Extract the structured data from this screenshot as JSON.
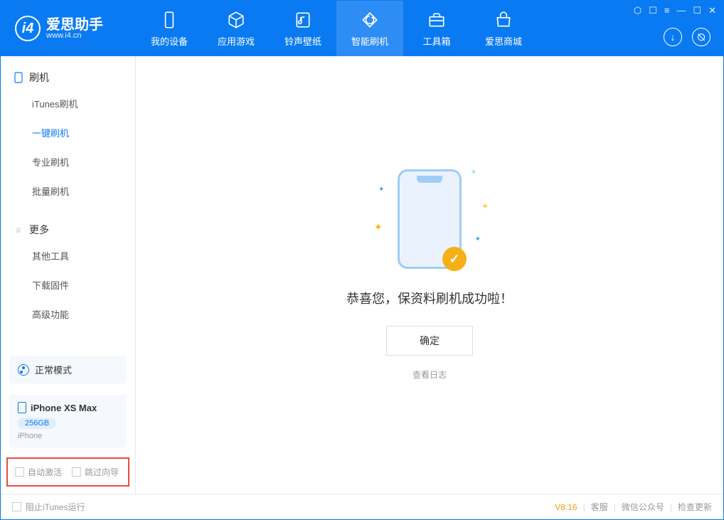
{
  "app": {
    "title": "爱思助手",
    "subtitle": "www.i4.cn"
  },
  "nav": [
    {
      "label": "我的设备"
    },
    {
      "label": "应用游戏"
    },
    {
      "label": "铃声壁纸"
    },
    {
      "label": "智能刷机"
    },
    {
      "label": "工具箱"
    },
    {
      "label": "爱思商城"
    }
  ],
  "sidebar": {
    "section1": {
      "title": "刷机",
      "items": [
        "iTunes刷机",
        "一键刷机",
        "专业刷机",
        "批量刷机"
      ]
    },
    "section2": {
      "title": "更多",
      "items": [
        "其他工具",
        "下载固件",
        "高级功能"
      ]
    }
  },
  "mode_label": "正常模式",
  "device": {
    "name": "iPhone XS Max",
    "storage": "256GB",
    "type": "iPhone"
  },
  "options": {
    "auto_activate": "自动激活",
    "skip_guide": "跳过向导"
  },
  "main": {
    "success": "恭喜您，保资料刷机成功啦！",
    "ok": "确定",
    "view_log": "查看日志"
  },
  "footer": {
    "block_itunes": "阻止iTunes运行",
    "version": "V8.16",
    "service": "客服",
    "wechat": "微信公众号",
    "update": "检查更新"
  }
}
